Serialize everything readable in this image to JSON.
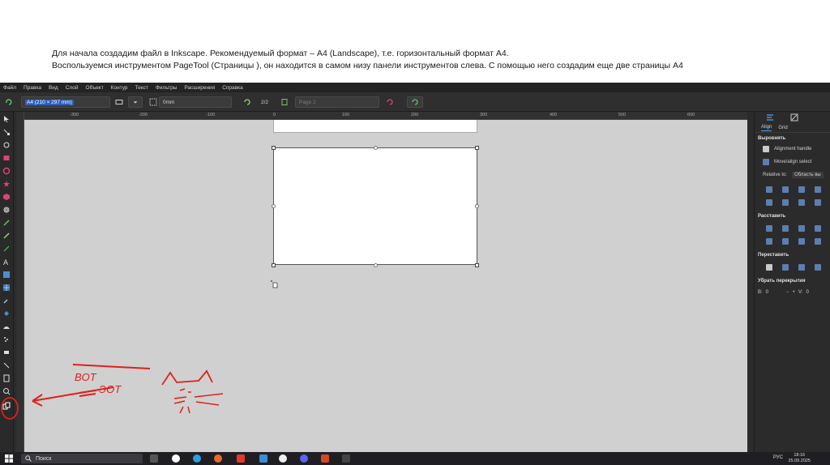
{
  "slide": {
    "line1": "Для начала создадим файл в Inkscape. Рекомендуемый формат – А4 (Landscape), т.е. горизонтальный формат А4.",
    "line2": "Воспользуемся инструментом PageTool (Страницы ), он находится в самом низу панели инструментов слева. С помощью него создадим еще две страницы А4"
  },
  "menu": [
    "Файл",
    "Правка",
    "Вид",
    "Слой",
    "Объект",
    "Контур",
    "Текст",
    "Фильтры",
    "Расширения",
    "Справка"
  ],
  "toolbar": {
    "page_size": "A4 (210 × 297 mm)",
    "margin": "0mm",
    "page_counter": "2/2",
    "page_label_placeholder": "Page 2"
  },
  "ruler": [
    "-300",
    "-200",
    "-100",
    "0",
    "100",
    "200",
    "300",
    "400",
    "500",
    "600"
  ],
  "panel": {
    "tab_align": "Align",
    "tab_grid": "Grid",
    "section_align": "Выровнять",
    "alignment_handles": "Alignment handle",
    "move_align": "Move/align select",
    "relative_label": "Relative to:",
    "relative_value": "Область вы",
    "section_distribute": "Расставить",
    "section_rearrange": "Переставить",
    "section_overlap": "Убрать перекрытия",
    "h_label": "В:",
    "h_value": "0",
    "v_label": "V:",
    "v_value": "0"
  },
  "taskbar": {
    "search": "Поиск",
    "lang": "РУС",
    "time": "18:16",
    "date": "25.09.2025"
  },
  "annotation": {
    "text1": "BOT",
    "text2": "ЭОТ"
  },
  "colors": {
    "canvas": "#d0d0d0",
    "accent": "#4aa3ff",
    "annotation": "#e0201a"
  }
}
